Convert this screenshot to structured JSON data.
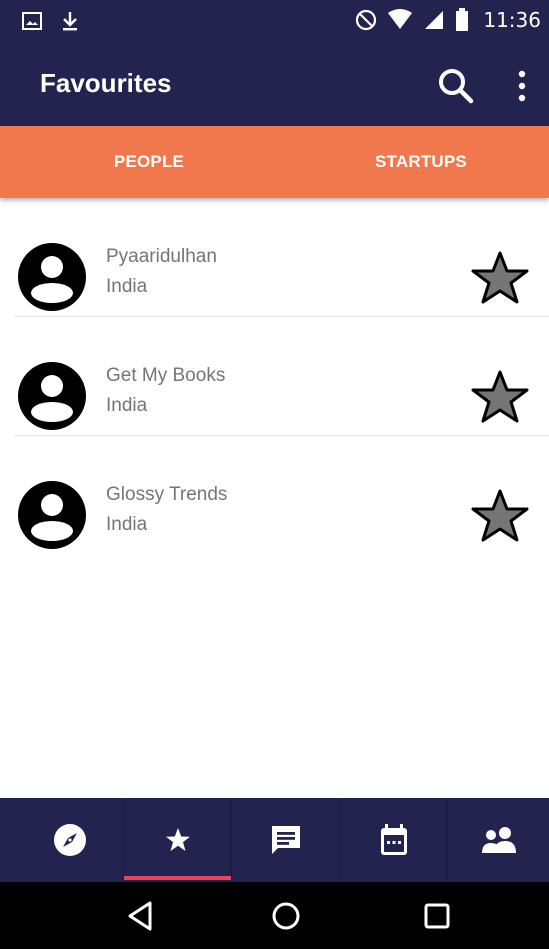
{
  "status_bar": {
    "time": "11:36",
    "icons": [
      "image-icon",
      "download-icon",
      "dnd-icon",
      "wifi-icon",
      "signal-icon",
      "battery-icon"
    ]
  },
  "app_bar": {
    "title": "Favourites",
    "icons": [
      "search-icon",
      "more-vert-icon"
    ]
  },
  "tabs": [
    {
      "label": "PEOPLE"
    },
    {
      "label": "STARTUPS"
    }
  ],
  "list": [
    {
      "name": "Pyaaridulhan",
      "country": "India"
    },
    {
      "name": "Get My Books",
      "country": "India"
    },
    {
      "name": "Glossy Trends",
      "country": "India"
    }
  ],
  "bottom_nav": {
    "items": [
      "compass-icon",
      "star-icon",
      "chat-icon",
      "calendar-icon",
      "people-icon"
    ],
    "active_index": 1
  },
  "system_nav": [
    "back-icon",
    "home-icon",
    "recents-icon"
  ],
  "colors": {
    "primary": "#23234f",
    "accent": "#f1784d",
    "active_indicator": "#f0415f"
  }
}
